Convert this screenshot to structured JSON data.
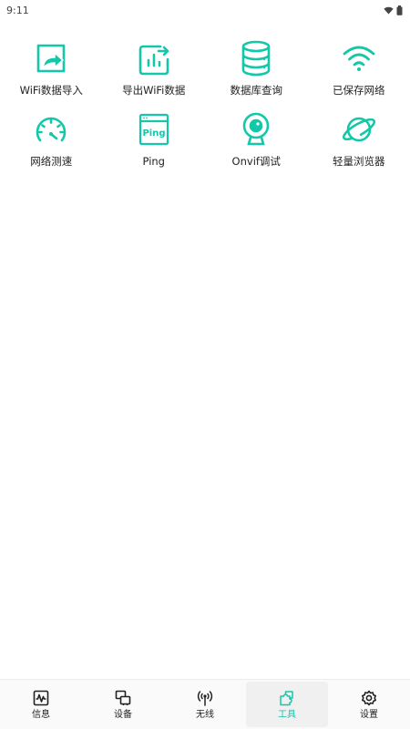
{
  "status_bar": {
    "time": "9:11",
    "icons": [
      "wifi-icon",
      "battery-icon"
    ]
  },
  "theme": {
    "accent": "#13C7A9",
    "text": "#222222"
  },
  "tools": [
    {
      "label": "WiFi数据导入",
      "icon": "wifi-import-icon"
    },
    {
      "label": "导出WiFi数据",
      "icon": "wifi-export-icon"
    },
    {
      "label": "数据库查询",
      "icon": "database-icon"
    },
    {
      "label": "已保存网络",
      "icon": "saved-wifi-icon"
    },
    {
      "label": "网络测速",
      "icon": "speedometer-icon"
    },
    {
      "label": "Ping",
      "icon": "ping-icon",
      "icon_text": "Ping"
    },
    {
      "label": "Onvif调试",
      "icon": "webcam-icon"
    },
    {
      "label": "轻量浏览器",
      "icon": "planet-icon"
    }
  ],
  "bottom_nav": {
    "active_index": 3,
    "items": [
      {
        "label": "信息",
        "icon": "pulse-icon"
      },
      {
        "label": "设备",
        "icon": "devices-icon"
      },
      {
        "label": "无线",
        "icon": "antenna-icon"
      },
      {
        "label": "工具",
        "icon": "puzzle-icon"
      },
      {
        "label": "设置",
        "icon": "settings-gear-icon"
      }
    ]
  }
}
